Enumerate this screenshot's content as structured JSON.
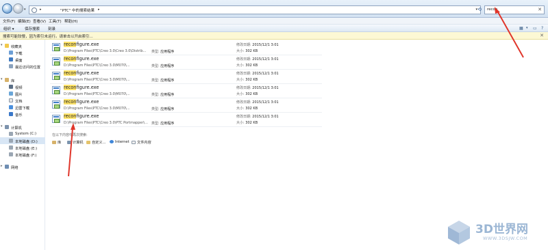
{
  "address": {
    "crumb": "\"PTC\" 中的搜索结果",
    "separator": "▸"
  },
  "search": {
    "value": "recon",
    "clear": "✕"
  },
  "menu": [
    "文件(F)",
    "编辑(E)",
    "查看(V)",
    "工具(T)",
    "帮助(H)"
  ],
  "toolbar": {
    "organize": "组织 ▾",
    "save_search": "保存搜索",
    "burn": "刻录"
  },
  "infobar": {
    "text": "搜索可能较慢，因为索引未运行。请单击以开启索引...",
    "close": "✕"
  },
  "nav": {
    "favorites": "收藏夹",
    "fav_items": [
      "下载",
      "桌面",
      "最近访问的位置"
    ],
    "libraries": "库",
    "lib_items": [
      "视频",
      "图片",
      "文档",
      "迅雷下载",
      "音乐"
    ],
    "computer": "计算机",
    "drives": [
      "System (C:)",
      "本地磁盘 (D:)",
      "本地磁盘 (E:)",
      "本地磁盘 (F:)"
    ],
    "network": "网络"
  },
  "results": [
    {
      "name_hl": "recon",
      "name_rest": "figure.exe",
      "path": "D:\\Program Files\\PTC\\Creo 3.0\\Creo 3.0\\Distrib...",
      "type_label": "类型:",
      "type": "应用程序",
      "date_label": "修改日期:",
      "date": "2015/12/1 3:01",
      "size_label": "大小:",
      "size": "302 KB"
    },
    {
      "name_hl": "recon",
      "name_rest": "figure.exe",
      "path": "D:\\Program Files\\PTC\\Creo 3.0\\M070\\...",
      "type_label": "类型:",
      "type": "应用程序",
      "date_label": "修改日期:",
      "date": "2015/12/1 3:01",
      "size_label": "大小:",
      "size": "302 KB"
    },
    {
      "name_hl": "recon",
      "name_rest": "figure.exe",
      "path": "D:\\Program Files\\PTC\\Creo 3.0\\M070\\...",
      "type_label": "类型:",
      "type": "应用程序",
      "date_label": "修改日期:",
      "date": "2015/12/1 3:01",
      "size_label": "大小:",
      "size": "302 KB"
    },
    {
      "name_hl": "recon",
      "name_rest": "figure.exe",
      "path": "D:\\Program Files\\PTC\\Creo 3.0\\M070\\...",
      "type_label": "类型:",
      "type": "应用程序",
      "date_label": "修改日期:",
      "date": "2015/12/1 3:01",
      "size_label": "大小:",
      "size": "302 KB"
    },
    {
      "name_hl": "recon",
      "name_rest": "figure.exe",
      "path": "D:\\Program Files\\PTC\\Creo 3.0\\M070\\...",
      "type_label": "类型:",
      "type": "应用程序",
      "date_label": "修改日期:",
      "date": "2015/12/1 3:01",
      "size_label": "大小:",
      "size": "302 KB"
    },
    {
      "name_hl": "recon",
      "name_rest": "figure.exe",
      "path": "D:\\Program Files\\PTC\\Creo 3.0\\PTC Portmapper\\...",
      "type_label": "类型:",
      "type": "应用程序",
      "date_label": "修改日期:",
      "date": "2015/12/1 3:01",
      "size_label": "大小:",
      "size": "302 KB"
    }
  ],
  "search_again": {
    "heading": "在以下内容中再次搜索:",
    "options": [
      "库",
      "计算机",
      "自定义...",
      "Internet",
      "文件内容"
    ]
  },
  "watermark": {
    "title": "3D世界网",
    "url": "WWW.3DSJW.COM"
  },
  "colors": {
    "highlight": "#ffe46a",
    "annotation_arrow": "#e0362b",
    "infobar_bg": "#fcf8d4"
  }
}
